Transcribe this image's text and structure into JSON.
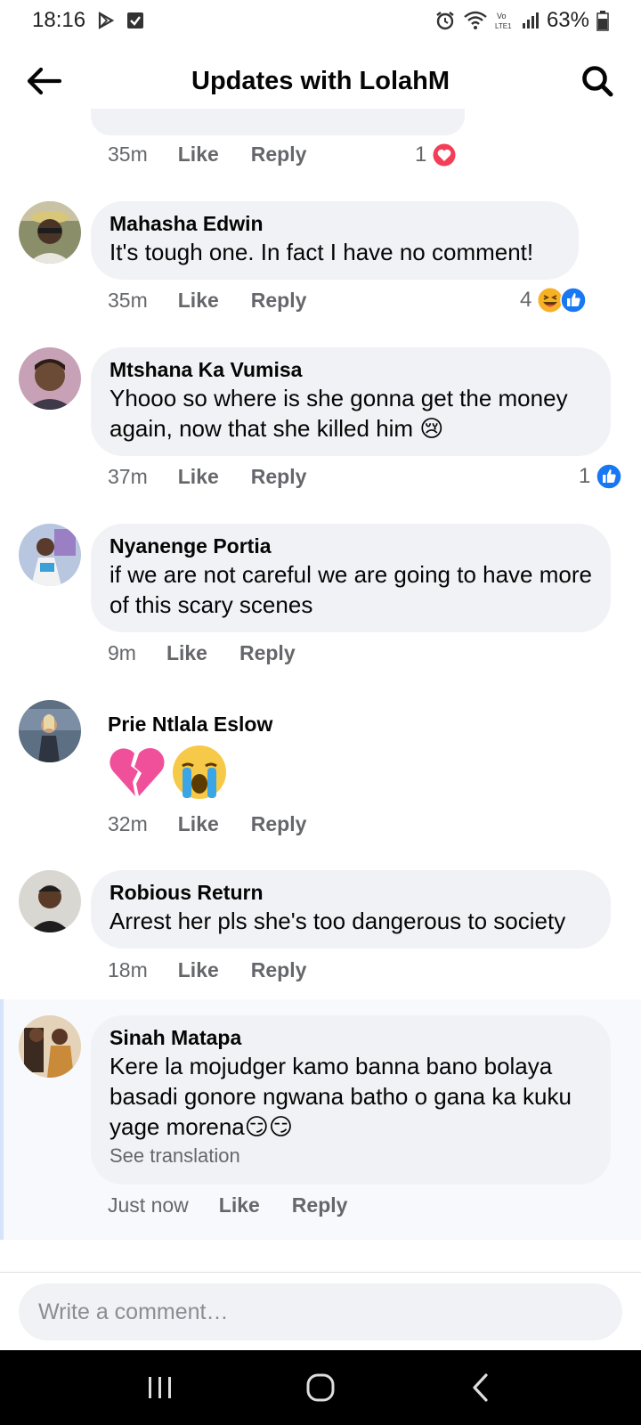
{
  "status_bar": {
    "time": "18:16",
    "battery": "63%",
    "icons": [
      "play-store-icon",
      "check-box-icon",
      "alarm-icon",
      "wifi-icon",
      "volte-icon",
      "signal-icon",
      "battery-icon"
    ]
  },
  "header": {
    "title": "Updates with LolahM",
    "back_icon": "arrow-left-icon",
    "search_icon": "search-icon"
  },
  "actions": {
    "like": "Like",
    "reply": "Reply"
  },
  "comments": [
    {
      "time": "35m",
      "reaction_count": "1",
      "reactions": [
        "love"
      ]
    },
    {
      "author": "Mahasha Edwin",
      "text": "It's tough one. In fact I have no comment!",
      "time": "35m",
      "reaction_count": "4",
      "reactions": [
        "haha",
        "like"
      ]
    },
    {
      "author": "Mtshana Ka Vumisa",
      "text": "Yhooo so where is she gonna get the money again, now that she killed him 😢",
      "time": "37m",
      "reaction_count": "1",
      "reactions": [
        "like"
      ]
    },
    {
      "author": "Nyanenge Portia",
      "text": "if we are not careful we are going to have more of this scary scenes",
      "time": "9m"
    },
    {
      "author": "Prie Ntlala Eslow",
      "text": "💔😭",
      "time": "32m"
    },
    {
      "author": "Robious Return",
      "text": "Arrest her pls she's too dangerous to society",
      "time": "18m"
    },
    {
      "author": "Sinah Matapa",
      "text": "Kere la mojudger kamo banna bano bolaya basadi gonore ngwana batho o gana ka kuku yage morena😏😏",
      "see_translation": "See translation",
      "time": "Just now"
    }
  ],
  "composer": {
    "placeholder": "Write a comment…"
  },
  "nav": {
    "icons": [
      "recent-apps-icon",
      "home-icon",
      "back-icon"
    ]
  },
  "colors": {
    "bubble": "#f0f2f5",
    "meta": "#65676b",
    "like_blue": "#1877f2",
    "love_red": "#f33e58",
    "haha_yellow": "#f7b125"
  }
}
